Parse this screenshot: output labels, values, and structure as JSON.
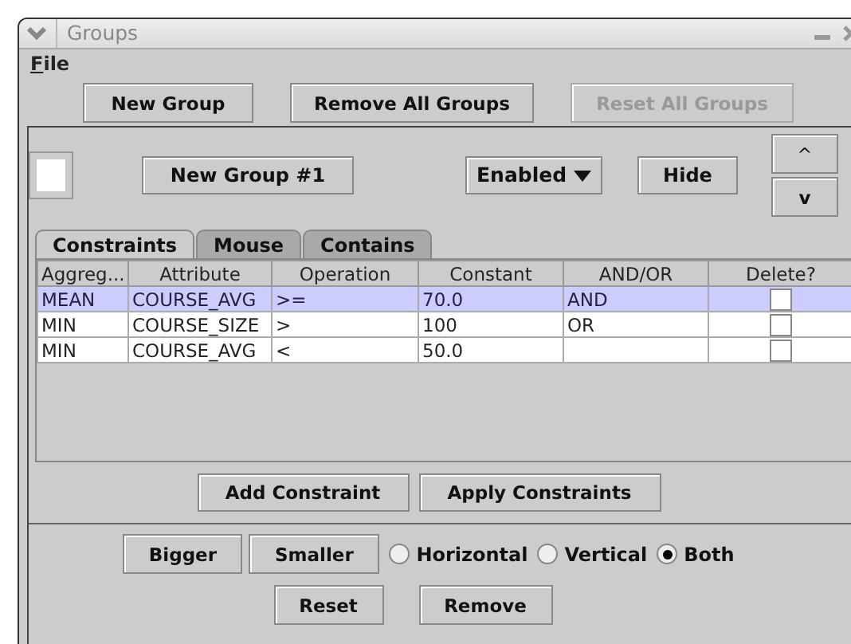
{
  "window": {
    "title": "Groups"
  },
  "menu": [
    {
      "label": "File"
    }
  ],
  "toolbar": [
    {
      "label": "New Group",
      "disabled": false
    },
    {
      "label": "Remove All Groups",
      "disabled": false
    },
    {
      "label": "Reset All Groups",
      "disabled": true
    }
  ],
  "group": {
    "color": "#ffffff",
    "name": "New Group #1",
    "status": "Enabled",
    "hide": "Hide",
    "up": "^",
    "down": "v"
  },
  "tabs": [
    {
      "label": "Constraints",
      "selected": true
    },
    {
      "label": "Mouse",
      "selected": false
    },
    {
      "label": "Contains",
      "selected": false
    }
  ],
  "table": {
    "columns": [
      "Aggreg...",
      "Attribute",
      "Operation",
      "Constant",
      "AND/OR",
      "Delete?"
    ],
    "rows": [
      {
        "cells": [
          "MEAN",
          "COURSE_AVG",
          ">=",
          "70.0",
          "AND"
        ],
        "delete": false,
        "selected": true
      },
      {
        "cells": [
          "MIN",
          "COURSE_SIZE",
          ">",
          "100",
          "OR"
        ],
        "delete": false,
        "selected": false
      },
      {
        "cells": [
          "MIN",
          "COURSE_AVG",
          "<",
          "50.0",
          ""
        ],
        "delete": false,
        "selected": false
      }
    ]
  },
  "constraint_buttons": [
    "Add Constraint",
    "Apply Constraints"
  ],
  "size_buttons": [
    "Bigger",
    "Smaller"
  ],
  "directions": [
    {
      "label": "Horizontal",
      "selected": false
    },
    {
      "label": "Vertical",
      "selected": false
    },
    {
      "label": "Both",
      "selected": true
    }
  ],
  "bottom_buttons": [
    "Reset",
    "Remove"
  ]
}
